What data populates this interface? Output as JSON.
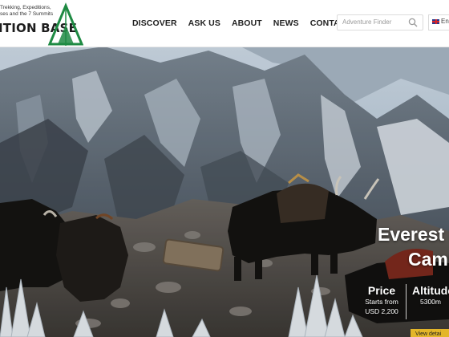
{
  "brand": {
    "tagline": [
      "Trekking, Expeditions,",
      "ses and the 7 Summits"
    ],
    "name": "ITION BASE",
    "accent": "#1e8a43"
  },
  "nav": {
    "items": [
      {
        "label": "DISCOVER"
      },
      {
        "label": "ASK US"
      },
      {
        "label": "ABOUT"
      },
      {
        "label": "NEWS"
      },
      {
        "label": "CONTACT"
      }
    ]
  },
  "search": {
    "placeholder": "Adventure Finder",
    "icon": "search-icon"
  },
  "language": {
    "label": "Eng",
    "icon": "uk-flag-icon"
  },
  "hero": {
    "title_line1": "Everest B",
    "title_line2": "Camp",
    "stats": {
      "price_label": "Price",
      "price_prefix": "Starts from",
      "price_value": "USD 2,200",
      "altitude_label": "Altitude",
      "altitude_value": "5300m"
    },
    "cta_label": "View detai"
  },
  "colors": {
    "cta_background": "#e3b62a",
    "header_background": "#ffffff"
  }
}
